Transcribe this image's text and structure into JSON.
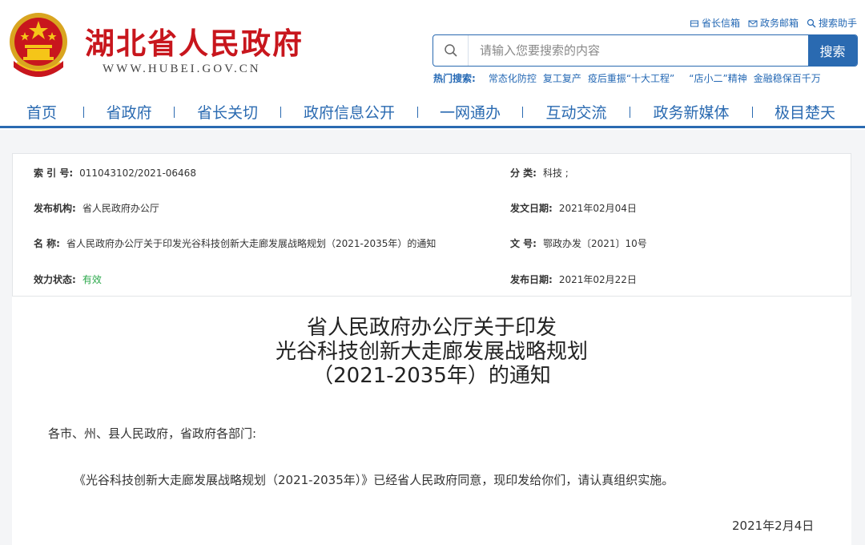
{
  "header": {
    "site_title": "湖北省人民政府",
    "site_url": "WWW.HUBEI.GOV.CN",
    "top_links": [
      {
        "label": "省长信箱",
        "icon": "mailbox-icon"
      },
      {
        "label": "政务邮箱",
        "icon": "envelope-icon"
      },
      {
        "label": "搜索助手",
        "icon": "search-icon"
      }
    ],
    "search": {
      "placeholder": "请输入您要搜索的内容",
      "button_label": "搜索"
    },
    "hot": {
      "label": "热门搜索:",
      "words": [
        "常态化防控",
        "复工复产",
        "疫后重振“十大工程”",
        "“店小二”精神",
        "金融稳保百千万"
      ]
    }
  },
  "nav": {
    "items": [
      "首页",
      "省政府",
      "省长关切",
      "政府信息公开",
      "一网通办",
      "互动交流",
      "政务新媒体",
      "极目楚天"
    ]
  },
  "info": {
    "index_key": "索 引 号:",
    "index_val": "011043102/2021-06468",
    "category_key": "分    类:",
    "category_val": "科技 ;",
    "publisher_key": "发布机构:",
    "publisher_val": "省人民政府办公厅",
    "issue_date_key": "发文日期:",
    "issue_date_val": "2021年02月04日",
    "name_key": "名    称:",
    "name_val": "省人民政府办公厅关于印发光谷科技创新大走廊发展战略规划（2021-2035年）的通知",
    "doc_no_key": "文    号:",
    "doc_no_val": "鄂政办发〔2021〕10号",
    "status_key": "效力状态:",
    "status_val": "有效",
    "pub_date_key": "发布日期:",
    "pub_date_val": "2021年02月22日",
    "status_color": "#2aa84a"
  },
  "article": {
    "title_lines": [
      "省人民政府办公厅关于印发",
      "光谷科技创新大走廊发展战略规划",
      "（2021-2035年）的通知"
    ],
    "salutation": "各市、州、县人民政府，省政府各部门:",
    "body": "《光谷科技创新大走廊发展战略规划（2021-2035年）》已经省人民政府同意，现印发给你们，请认真组织实施。",
    "date": "2021年2月4日"
  },
  "colors": {
    "brand_red": "#c8161d",
    "brand_blue": "#2a6ab1"
  }
}
